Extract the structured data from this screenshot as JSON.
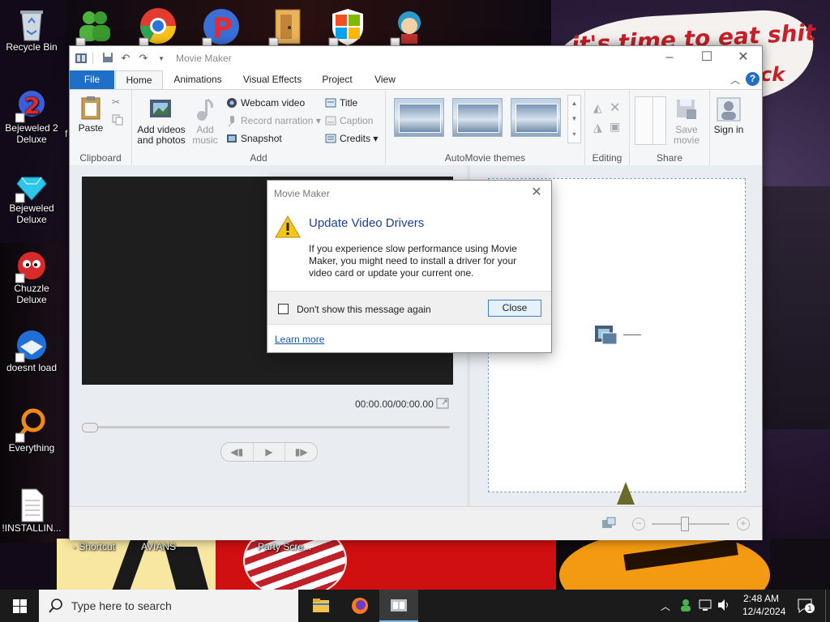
{
  "desktop": {
    "wallpaper_text": "it's time to eat shit",
    "wallpaper_text2": "ck",
    "icons": [
      {
        "label": "Recycle Bin"
      },
      {
        "label": "Bejeweled 2 Deluxe"
      },
      {
        "label": "Bejeweled Deluxe"
      },
      {
        "label": "Chuzzle Deluxe"
      },
      {
        "label": "doesnt load"
      },
      {
        "label": "Everything"
      },
      {
        "label": "!INSTALLIN..."
      }
    ],
    "partial_labels": [
      "f",
      "- Shortcut",
      "AVIANS",
      "Party Scre..."
    ]
  },
  "window": {
    "title": "Movie Maker",
    "tabs": [
      "File",
      "Home",
      "Animations",
      "Visual Effects",
      "Project",
      "View"
    ],
    "ribbon": {
      "clipboard": {
        "paste": "Paste",
        "group": "Clipboard"
      },
      "add": {
        "add_videos": "Add videos and photos",
        "add_music": "Add music",
        "webcam": "Webcam video",
        "record": "Record narration",
        "snapshot": "Snapshot",
        "title": "Title",
        "caption": "Caption",
        "credits": "Credits",
        "group": "Add"
      },
      "automovie": {
        "group": "AutoMovie themes"
      },
      "editing": {
        "group": "Editing"
      },
      "share": {
        "save_movie": "Save movie",
        "group": "Share"
      },
      "sign_in": "Sign in"
    },
    "timecode": "00:00.00/00:00.00"
  },
  "dialog": {
    "title": "Movie Maker",
    "heading": "Update Video Drivers",
    "body": "If you experience slow performance using Movie Maker, you might need to install a driver for your video card or update your current one.",
    "checkbox_label": "Don't show this message again",
    "close_label": "Close",
    "link": "Learn more"
  },
  "taskbar": {
    "search_placeholder": "Type here to search",
    "time": "2:48 AM",
    "date": "12/4/2024",
    "notification_count": "1"
  }
}
